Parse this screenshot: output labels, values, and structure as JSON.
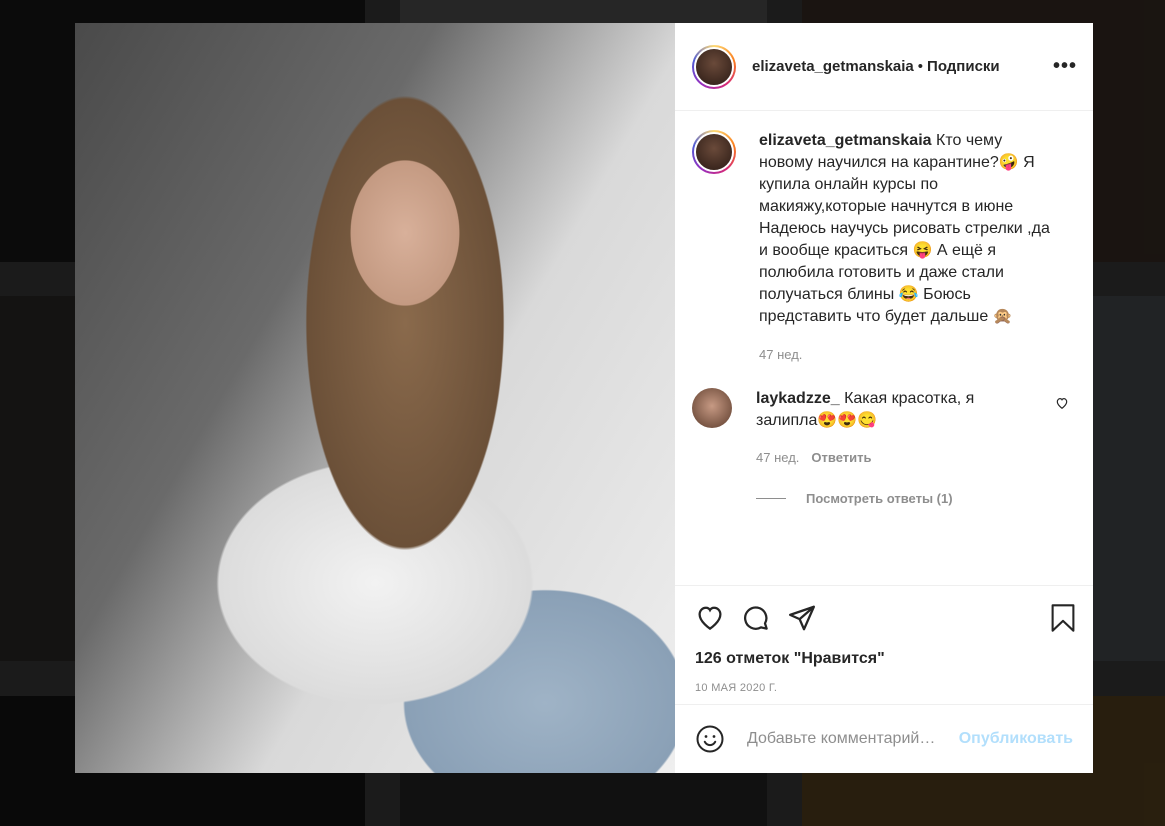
{
  "post": {
    "username": "elizaveta_getmanskaia",
    "follow_separator": "•",
    "follow_label": "Подписки",
    "more_icon": "more-dots-icon"
  },
  "caption": {
    "username": "elizaveta_getmanskaia",
    "text": "Кто чему новому научился на карантине?🤪 Я купила онлайн курсы по макияжу,которые начнутся в июне Надеюсь научусь рисовать стрелки ,да и вообще краситься 😝 А ещё я полюбила готовить и даже стали получаться блины 😂 Боюсь представить что будет дальше 🙊",
    "time": "47 нед."
  },
  "comments": [
    {
      "username": "laykadzze_",
      "text": "Какая красотка, я залипла😍😍😋",
      "time": "47 нед.",
      "reply_label": "Ответить",
      "view_replies_label": "Посмотреть ответы (1)"
    }
  ],
  "actions": {
    "likes_text": "126 отметок \"Нравится\"",
    "date": "10 МАЯ 2020 Г."
  },
  "add_comment": {
    "placeholder": "Добавьте комментарий…",
    "publish_label": "Опубликовать"
  },
  "colors": {
    "text": "#262626",
    "secondary": "#8e8e8e",
    "publish_disabled": "#b2dffc"
  }
}
